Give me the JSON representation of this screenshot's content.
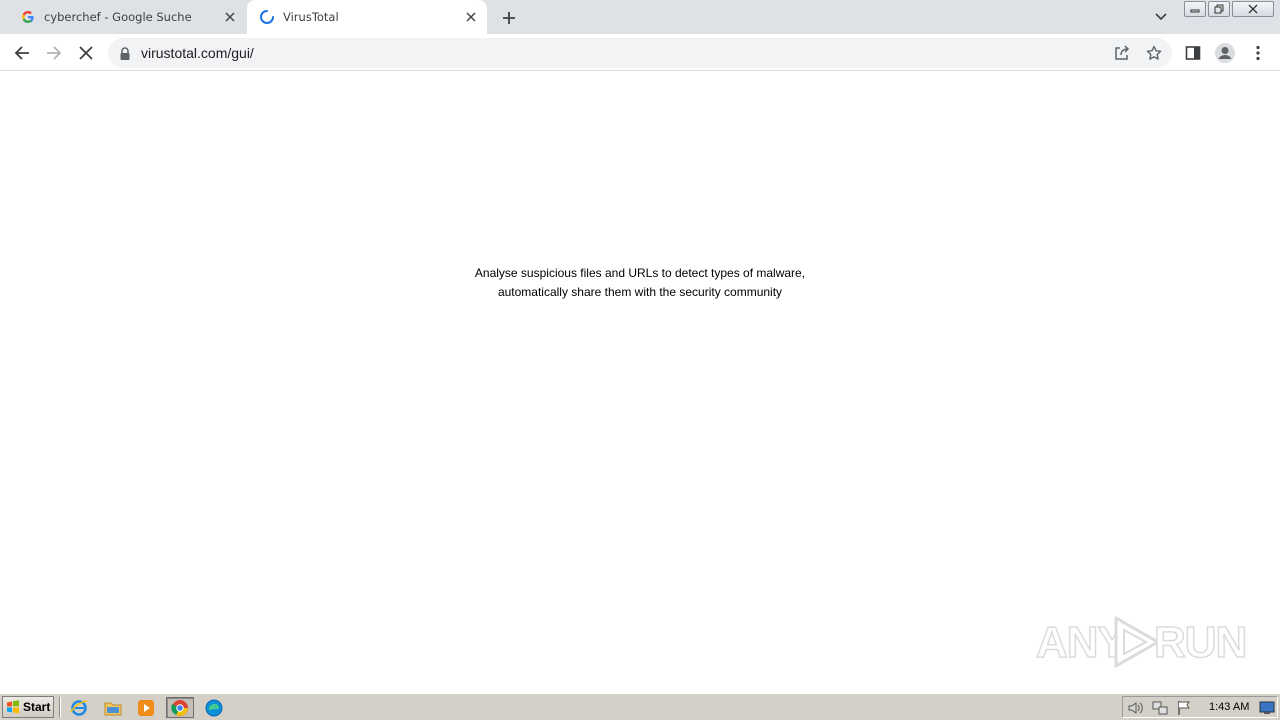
{
  "browser": {
    "tabs": [
      {
        "title": "cyberchef - Google Suche",
        "favicon": "google-g-icon",
        "active": false
      },
      {
        "title": "VirusTotal",
        "favicon": "loading-spinner-icon",
        "active": true
      }
    ],
    "address_bar": {
      "url": "virustotal.com/gui/"
    },
    "colors": {
      "tabstrip": "#dee1e6",
      "omnibox": "#f1f3f4",
      "spinner": "#1a73e8"
    }
  },
  "page": {
    "tagline_line1": "Analyse suspicious files and URLs to detect types of malware,",
    "tagline_line2": "automatically share them with the security community"
  },
  "watermark": {
    "left": "ANY",
    "right": "RUN"
  },
  "taskbar": {
    "start_label": "Start",
    "apps": [
      "internet-explorer-icon",
      "file-explorer-icon",
      "media-player-icon",
      "chrome-icon",
      "edge-icon"
    ],
    "clock": "1:43 AM"
  }
}
